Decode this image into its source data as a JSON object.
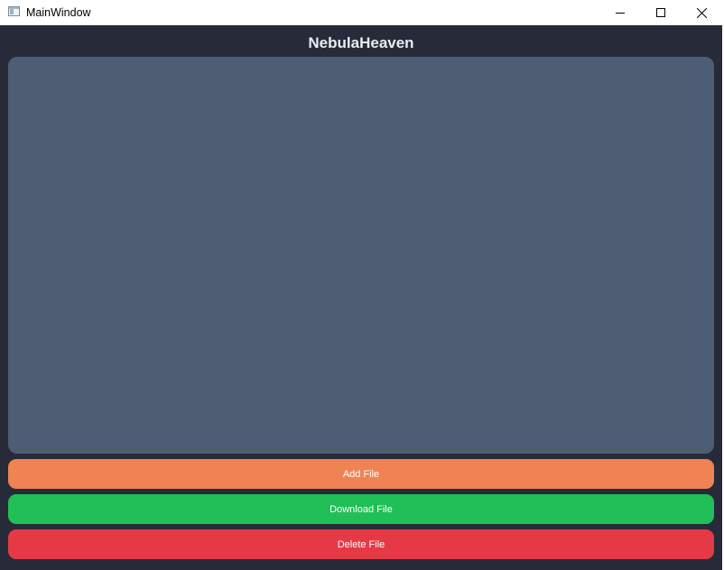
{
  "window": {
    "title": "MainWindow",
    "icon": "app-window-icon",
    "controls": [
      "minimize-icon",
      "maximize-icon",
      "close-icon"
    ]
  },
  "app": {
    "heading": "NebulaHeaven"
  },
  "file_list": {
    "items": []
  },
  "buttons": {
    "add_label": "Add File",
    "download_label": "Download File",
    "delete_label": "Delete File"
  },
  "colors": {
    "background": "#272a38",
    "list_panel": "#4f5d74",
    "add": "#ef8354",
    "download": "#21bf57",
    "delete": "#e63946"
  }
}
